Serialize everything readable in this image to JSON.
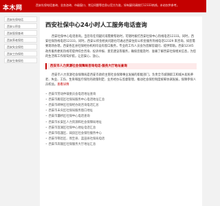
{
  "header": {
    "logo": "本木网",
    "notice": "西安社保电话查询、业务咨询、市级窗口、常见问题等信息以官方为准，如有疑问请拨打12333热线，本站仅供参考。"
  },
  "sidebar": {
    "items": [
      "西安社保电话",
      "西安公积金",
      "西安医保查询",
      "西安养老保险",
      "西安失业保险",
      "西安工伤保险",
      "西安生育保险"
    ]
  },
  "article": {
    "title": "西安社保中心24小时人工服务电话查询",
    "paragraph1": "西安社保中心电话查询。当您有任何疑问或需要帮助时，可随时拨打西安社保中心热线电话12333。同时，西安社保热线电话12333，同时，西安公积金相关问题也可通过西安住房公积金服务热线电话12329 来咨询。如您需要现场办理，西安各区县社保经办机构均设有窗口服务，专业的工作人员会为您解答疑问、提供帮助。西安12345 政务服务便民热线可提供综合咨询、投诉举报、意见建议等服务，确保您能及时、准确了解西安社保相关信息，为您的生活和工作保驾护航，让您安心、放心。",
    "section_title": "西安市人力资源社会保障局咨询电话·服务大厅地址查询",
    "paragraph2": "西安市人力资源社会保障局是西安市政府主管社会保障事业发展的职能部门，负责全市城镇职工和城乡居民养老、失业、工伤、生育和医疗保险的政策制定、业务经办与监督管理，推动社会保险制度统筹协调发展，保障参保人员权益。",
    "more_label": "查看详情",
    "links": [
      "西安市劳动仲裁委员会电话地址查询",
      "西安市雁塔区社保局服务中心电话地址汇总",
      "西安市碑林区社保经办处咨询电话汇总",
      "西安市未央区社保局服务窗口地址",
      "西安市灞桥区社保中心电话查询",
      "西安市长安区人力资源和社会保障局地址",
      "西安市莲湖区社保中心地址电话汇总",
      "西安市临潼区、阎良区社会保险服务中心",
      "西安市鄠邑区、周至县、蓝田县社保局电话",
      "西安市高陵区社保服务大厅地址汇总"
    ]
  }
}
